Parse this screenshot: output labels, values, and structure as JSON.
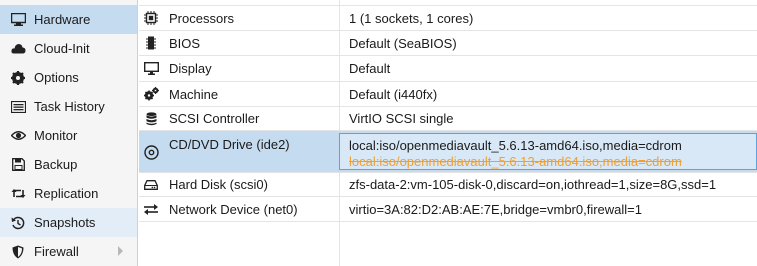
{
  "sidebar": {
    "items": [
      {
        "label": "Hardware",
        "icon": "monitor-icon"
      },
      {
        "label": "Cloud-Init",
        "icon": "cloud-icon"
      },
      {
        "label": "Options",
        "icon": "gear-icon"
      },
      {
        "label": "Task History",
        "icon": "list-icon"
      },
      {
        "label": "Monitor",
        "icon": "eye-icon"
      },
      {
        "label": "Backup",
        "icon": "floppy-icon"
      },
      {
        "label": "Replication",
        "icon": "retweet-icon"
      },
      {
        "label": "Snapshots",
        "icon": "history-icon"
      },
      {
        "label": "Firewall",
        "icon": "shield-icon"
      }
    ]
  },
  "hardware": {
    "rows": [
      {
        "key": "Processors",
        "value": "1 (1 sockets, 1 cores)",
        "icon": "cpu-icon"
      },
      {
        "key": "BIOS",
        "value": "Default (SeaBIOS)",
        "icon": "chip-icon"
      },
      {
        "key": "Display",
        "value": "Default",
        "icon": "desktop-icon"
      },
      {
        "key": "Machine",
        "value": "Default (i440fx)",
        "icon": "cogs-icon"
      },
      {
        "key": "SCSI Controller",
        "value": "VirtIO SCSI single",
        "icon": "database-icon"
      },
      {
        "key": "CD/DVD Drive (ide2)",
        "value": "local:iso/openmediavault_5.6.13-amd64.iso,media=cdrom",
        "pending_old": "local:iso/openmediavault_5.6.13-amd64.iso,media=cdrom",
        "icon": "cdrom-icon"
      },
      {
        "key": "Hard Disk (scsi0)",
        "value": "zfs-data-2:vm-105-disk-0,discard=on,iothread=1,size=8G,ssd=1",
        "icon": "hdd-icon"
      },
      {
        "key": "Network Device (net0)",
        "value": "virtio=3A:82:D2:AB:AE:7E,bridge=vmbr0,firewall=1",
        "icon": "exchange-icon"
      }
    ]
  },
  "colors": {
    "selected": "#c5dcf0",
    "pending": "#f0a030",
    "edit_border": "#5fa2dd"
  }
}
